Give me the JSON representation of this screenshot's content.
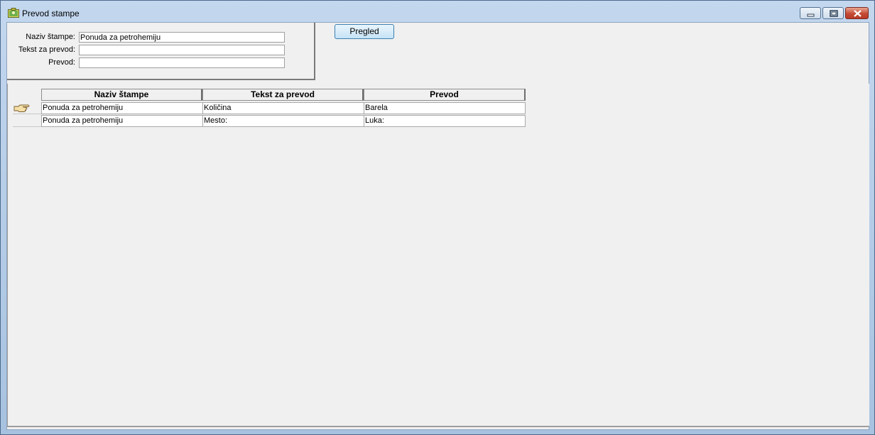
{
  "window": {
    "title": "Prevod stampe"
  },
  "filter": {
    "naziv_label": "Naziv štampe:",
    "naziv_value": "Ponuda za petrohemiju",
    "tekst_label": "Tekst za prevod:",
    "tekst_value": "",
    "prevod_label": "Prevod:",
    "prevod_value": ""
  },
  "toolbar": {
    "pregled_label": "Pregled"
  },
  "grid": {
    "columns": [
      "Naziv štampe",
      "Tekst za prevod",
      "Prevod"
    ],
    "rows": [
      [
        "Ponuda za petrohemiju",
        "Količina",
        "Barela"
      ],
      [
        "Ponuda za petrohemiju",
        "Mesto:",
        "Luka:"
      ]
    ],
    "current_row_icon": "pointing-hand-icon"
  }
}
